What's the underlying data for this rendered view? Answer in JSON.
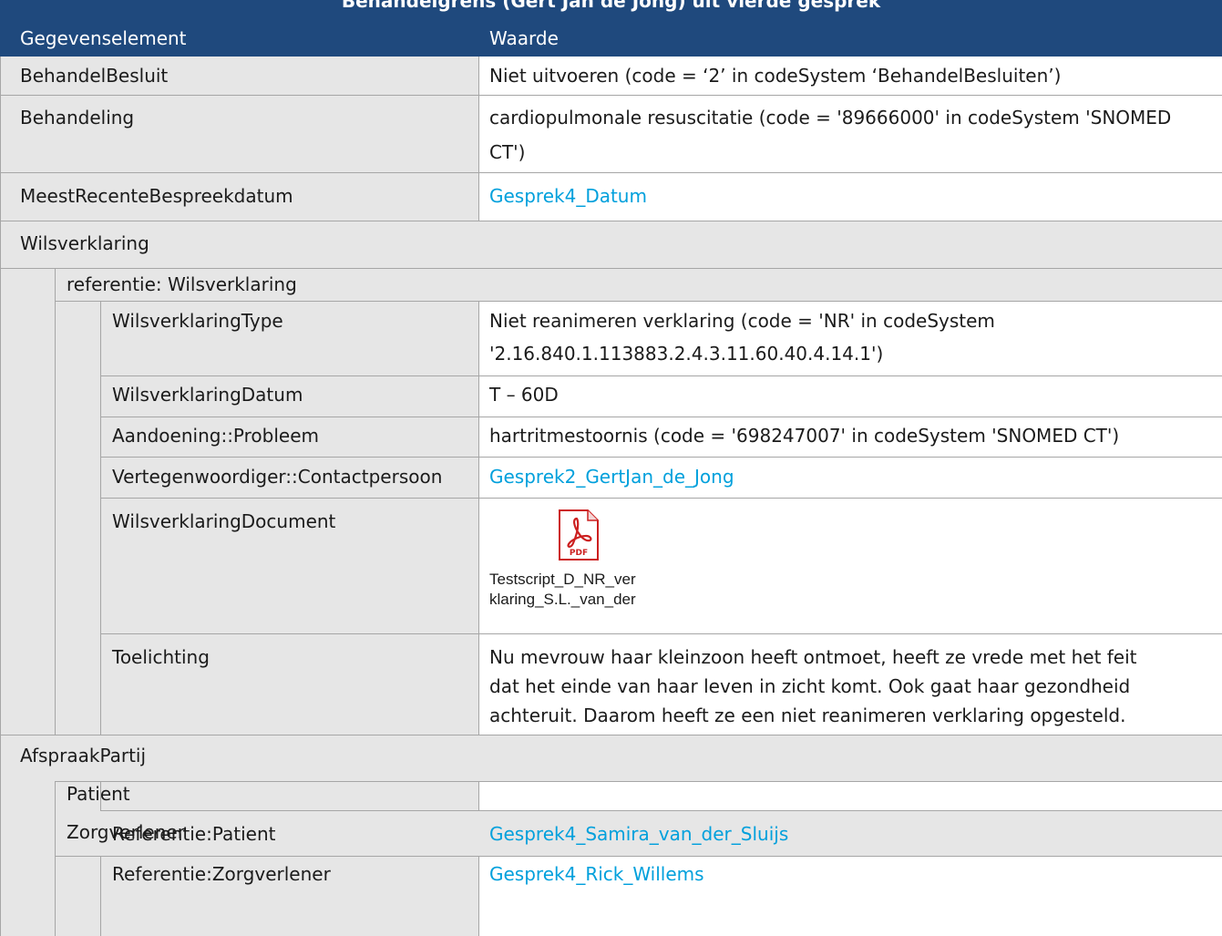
{
  "table": {
    "title": "Behandelgrens (Gert Jan de Jong) uit vierde gesprek",
    "headers": {
      "element": "Gegevenselement",
      "value": "Waarde"
    },
    "rows": [
      {
        "label": "BehandelBesluit",
        "value": "Niet uitvoeren (code = ‘2’ in codeSystem ‘BehandelBesluiten’)"
      },
      {
        "label": "Behandeling",
        "value_lines": [
          "cardiopulmonale resuscitatie (code = '89666000' in codeSystem 'SNOMED",
          "CT')"
        ]
      },
      {
        "label": "MeestRecenteBespreekdatum",
        "value": "Gesprek4_Datum"
      },
      {
        "label": "Wilsverklaring"
      },
      {
        "label": "referentie: Wilsverklaring"
      },
      {
        "label": "WilsverklaringType",
        "value_lines": [
          "Niet reanimeren verklaring (code = 'NR' in codeSystem",
          "'2.16.840.1.113883.2.4.3.11.60.40.4.14.1')"
        ]
      },
      {
        "label": "WilsverklaringDatum",
        "value": "T – 60D"
      },
      {
        "label": "Aandoening::Probleem",
        "value": "hartritmestoornis (code = '698247007' in codeSystem 'SNOMED CT')"
      },
      {
        "label": "Vertegenwoordiger::Contactpersoon",
        "value": "Gesprek2_GertJan_de_Jong"
      },
      {
        "label": "WilsverklaringDocument",
        "value_icon": "pdf-icon",
        "value_caption_lines": [
          "Testscript_D_NR_ver",
          "klaring_S.L._van_der"
        ]
      },
      {
        "label": "Toelichting",
        "value_lines": [
          "Nu mevrouw haar kleinzoon heeft ontmoet, heeft ze vrede met het feit",
          "dat het einde van haar leven in zicht komt. Ook gaat haar gezondheid",
          "achteruit. Daarom heeft ze een niet reanimeren verklaring opgesteld."
        ]
      },
      {
        "label": "AfspraakPartij"
      },
      {
        "label": "Patient"
      },
      {
        "label": "Referentie:Patient",
        "value": "Gesprek4_Samira_van_der_Sluijs"
      },
      {
        "label": "Zorgverlener"
      },
      {
        "label": "Referentie:Zorgverlener",
        "value": "Gesprek4_Rick_Willems"
      }
    ]
  },
  "colors": {
    "header_background": "#1f497d",
    "label_cell": "#e6e6e6",
    "value_cell": "#ffffff",
    "link": "#00a0dc",
    "pdf_icon": "#cc1f1f"
  }
}
